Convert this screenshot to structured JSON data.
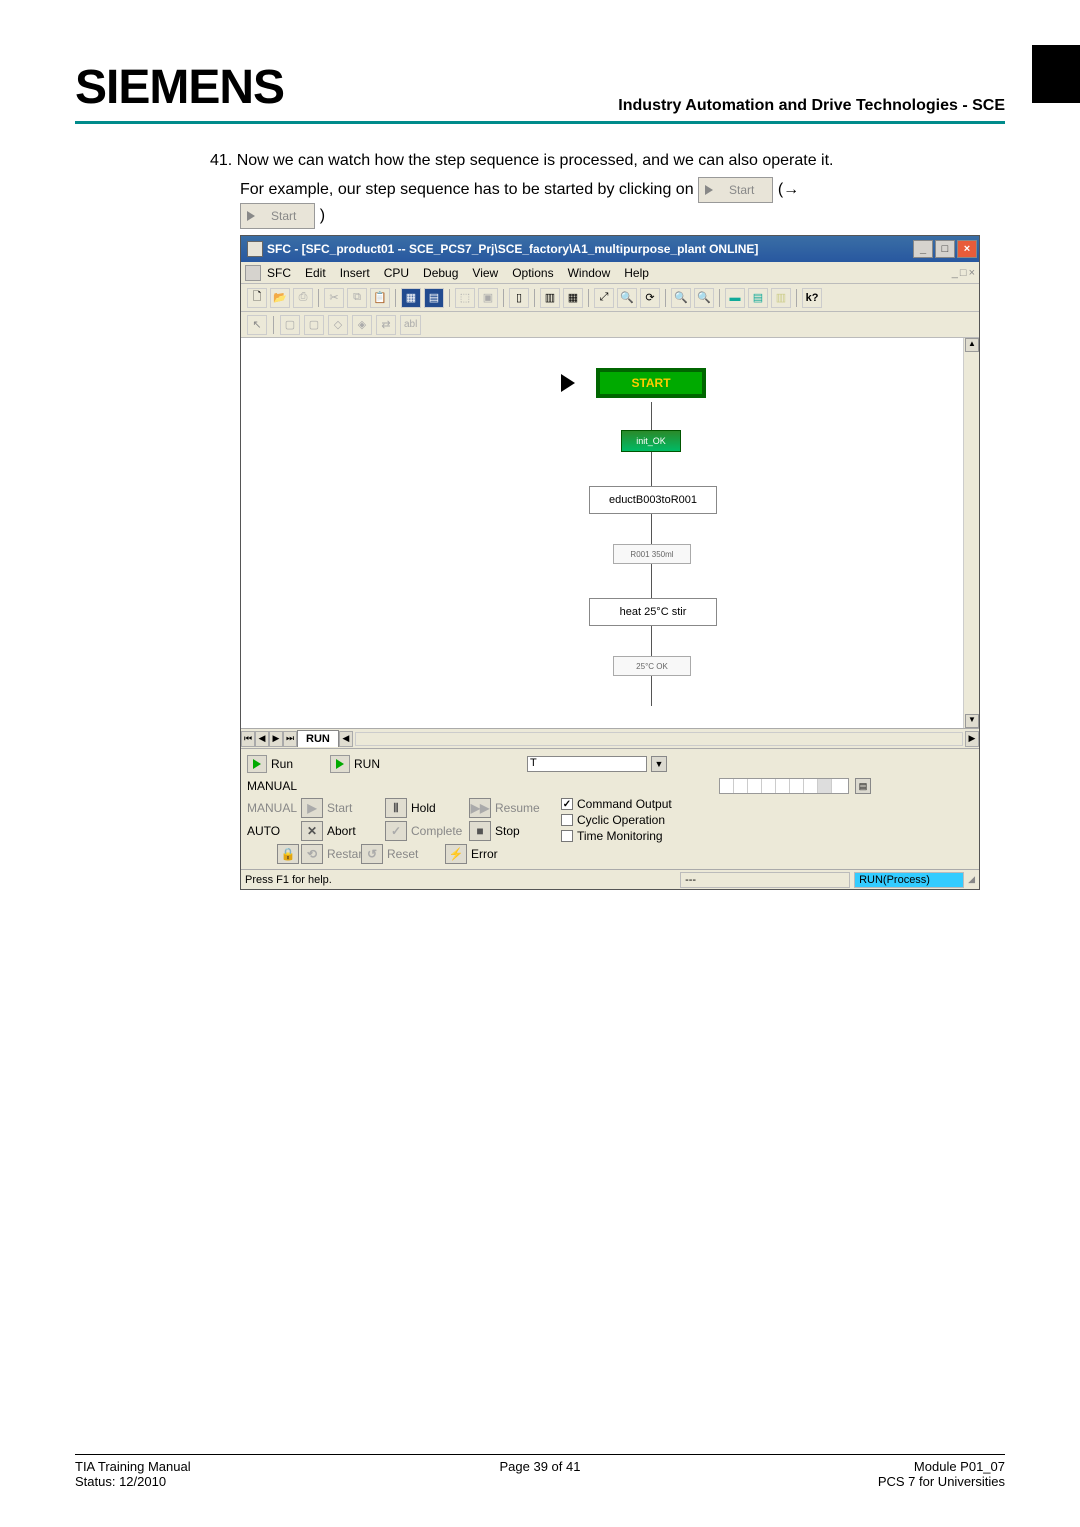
{
  "header": {
    "logo": "SIEMENS",
    "title": "Industry Automation and Drive Technologies - SCE"
  },
  "body": {
    "step_num": "41.",
    "line1": "Now we can watch how the step sequence is processed, and we can also operate it.",
    "line2a": "For example, our step sequence has to be started by clicking on ",
    "start_btn": "Start",
    "arrow": "(→",
    "close_paren": ")"
  },
  "win": {
    "title": "SFC - [SFC_product01 -- SCE_PCS7_Prj\\SCE_factory\\A1_multipurpose_plant  ONLINE]",
    "menu": [
      "SFC",
      "Edit",
      "Insert",
      "CPU",
      "Debug",
      "View",
      "Options",
      "Window",
      "Help"
    ],
    "mdi_close": [
      "_",
      "□",
      "×"
    ]
  },
  "sfc": {
    "start": "START",
    "trans1": "init_OK",
    "step1": "eductB003toR001",
    "step2": "R001 350ml",
    "step3": "heat 25°C stir",
    "trans2": "25°C OK",
    "tab": "RUN"
  },
  "ctrl": {
    "run_lbl": "Run",
    "run_state": "RUN",
    "t_field": "T",
    "manual": "MANUAL",
    "manual_dim": "MANUAL",
    "auto": "AUTO",
    "start": "Start",
    "abort": "Abort",
    "restart": "Restart",
    "hold": "Hold",
    "complete": "Complete",
    "reset": "Reset",
    "resume": "Resume",
    "stop": "Stop",
    "error": "Error",
    "cmd_out": "Command Output",
    "cyclic": "Cyclic Operation",
    "timemon": "Time Monitoring"
  },
  "status": {
    "help": "Press F1 for help.",
    "mid": "---",
    "run": "RUN(Process)"
  },
  "footer": {
    "l1": "TIA Training Manual",
    "l2": "Status: 12/2010",
    "mid": "Page 39 of 41",
    "r1": "Module P01_07",
    "r2": "PCS 7 for Universities"
  }
}
